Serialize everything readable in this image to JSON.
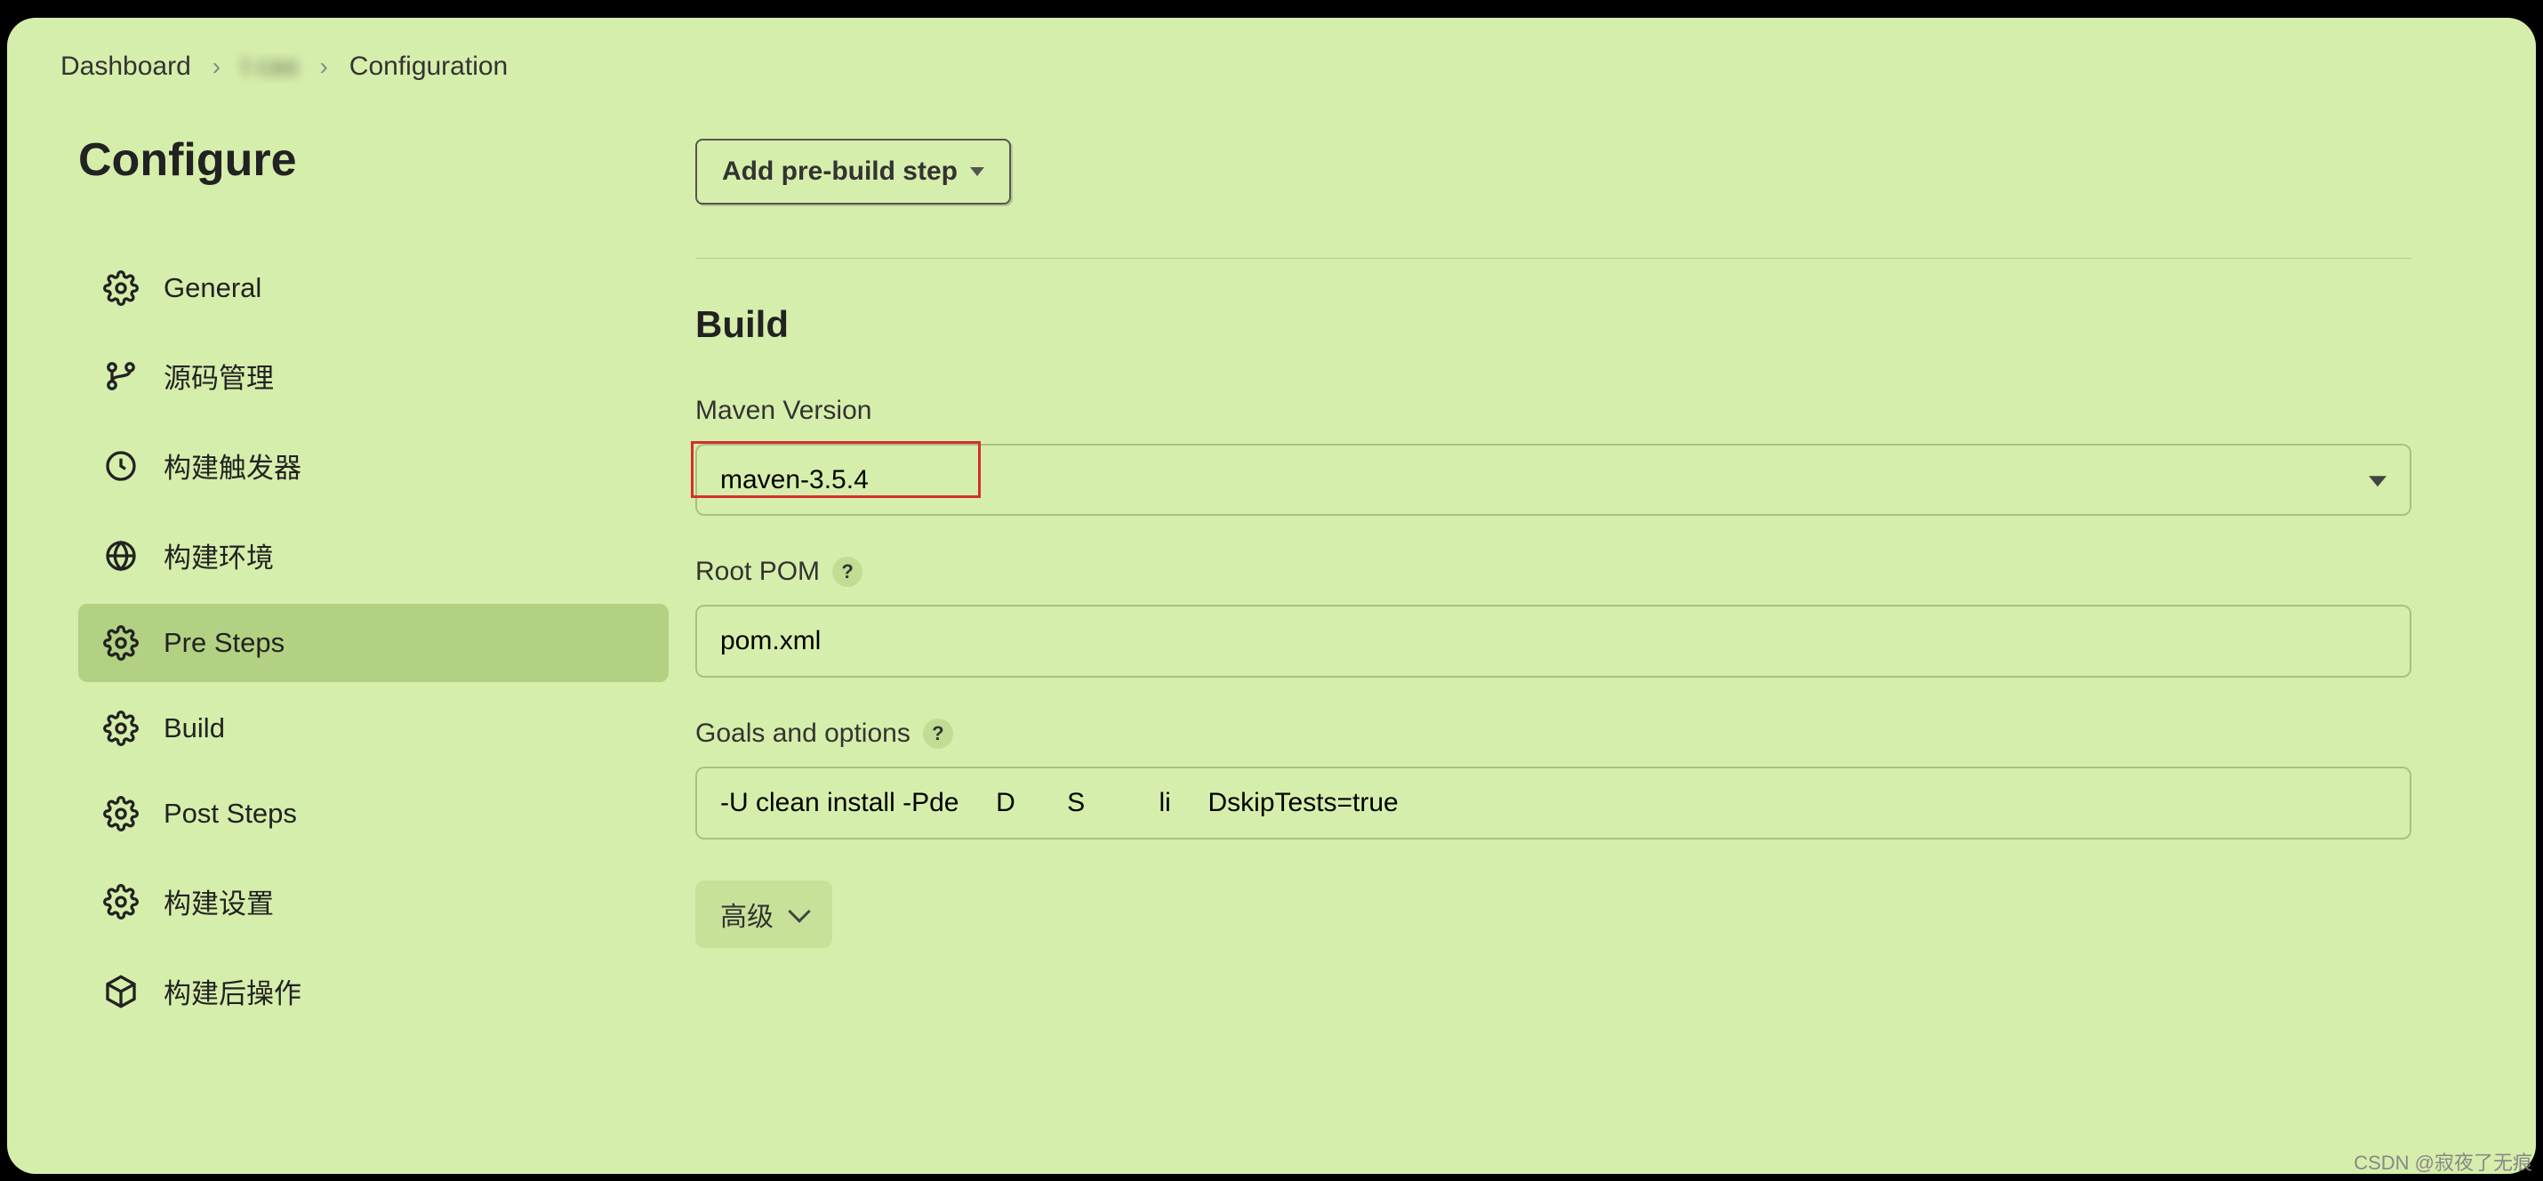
{
  "breadcrumb": {
    "items": [
      {
        "label": "Dashboard",
        "blurred": false
      },
      {
        "label": "t            cas",
        "blurred": true
      },
      {
        "label": "Configuration",
        "blurred": false
      }
    ]
  },
  "page_title": "Configure",
  "sidebar": {
    "items": [
      {
        "id": "general",
        "label": "General",
        "icon": "gear",
        "active": false
      },
      {
        "id": "scm",
        "label": "源码管理",
        "icon": "branch",
        "active": false
      },
      {
        "id": "triggers",
        "label": "构建触发器",
        "icon": "clock",
        "active": false
      },
      {
        "id": "env",
        "label": "构建环境",
        "icon": "globe",
        "active": false
      },
      {
        "id": "presteps",
        "label": "Pre Steps",
        "icon": "gear",
        "active": true
      },
      {
        "id": "build",
        "label": "Build",
        "icon": "gear",
        "active": false
      },
      {
        "id": "poststeps",
        "label": "Post Steps",
        "icon": "gear",
        "active": false
      },
      {
        "id": "settings",
        "label": "构建设置",
        "icon": "gear",
        "active": false
      },
      {
        "id": "postactions",
        "label": "构建后操作",
        "icon": "package",
        "active": false
      }
    ]
  },
  "main": {
    "add_step_label": "Add pre-build step",
    "section_heading": "Build",
    "maven_version": {
      "label": "Maven Version",
      "value": "maven-3.5.4"
    },
    "root_pom": {
      "label": "Root POM",
      "value": "pom.xml"
    },
    "goals": {
      "label": "Goals and options",
      "value": "-U clean install -Pde     D       S          li     DskipTests=true"
    },
    "advanced_label": "高级"
  },
  "watermark": "CSDN @寂夜了无痕"
}
